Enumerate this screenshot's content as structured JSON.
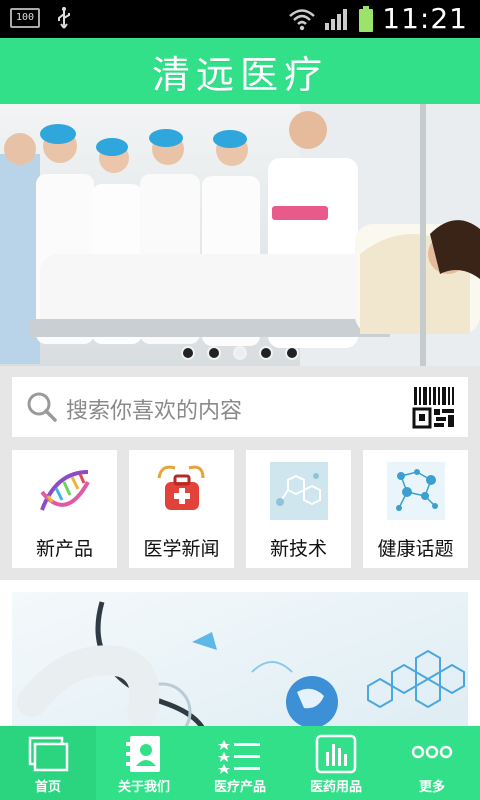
{
  "status_bar": {
    "battery_small": "100",
    "time": "11:21"
  },
  "header": {
    "title": "清远医疗"
  },
  "banner": {
    "dots": 5,
    "active_dot": 2
  },
  "search": {
    "placeholder": "搜索你喜欢的内容"
  },
  "categories": [
    {
      "label": "新产品",
      "icon": "dna-icon"
    },
    {
      "label": "医学新闻",
      "icon": "medical-kit-icon"
    },
    {
      "label": "新技术",
      "icon": "molecule-tech-icon"
    },
    {
      "label": "健康话题",
      "icon": "health-network-icon"
    }
  ],
  "tabbar": {
    "items": [
      {
        "label": "首页",
        "icon": "home-icon"
      },
      {
        "label": "关于我们",
        "icon": "contact-icon"
      },
      {
        "label": "医疗产品",
        "icon": "list-icon"
      },
      {
        "label": "医药用品",
        "icon": "chart-icon"
      },
      {
        "label": "更多",
        "icon": "more-icon"
      }
    ]
  },
  "colors": {
    "brand": "#33e08a",
    "status_bar": "#000000"
  }
}
